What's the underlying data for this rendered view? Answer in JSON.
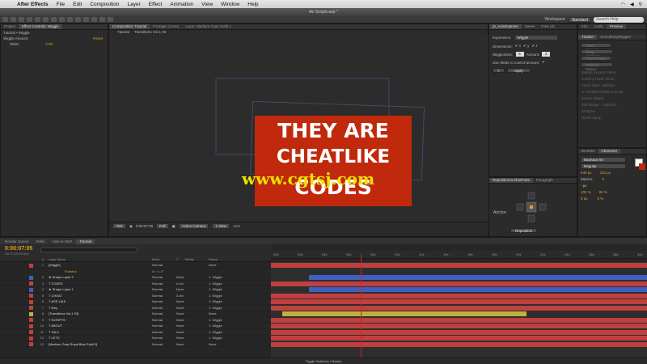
{
  "menubar": {
    "apple": "",
    "app": "After Effects",
    "items": [
      "File",
      "Edit",
      "Composition",
      "Layer",
      "Effect",
      "Animation",
      "View",
      "Window",
      "Help"
    ],
    "clock": ""
  },
  "window": {
    "title": "Ae Scripts.aep *"
  },
  "toolbar": {
    "workspace_label": "Workspace:",
    "workspace": "Standard",
    "search_placeholder": "Search Help"
  },
  "effects_panel": {
    "tabs": [
      "Project",
      "Effect Controls: Wiggle"
    ],
    "breadcrumb": "Tutorial • Wiggle",
    "rows": [
      {
        "label": "Wiggle Amount",
        "value": "Reset"
      },
      {
        "label": "Slider",
        "value": "2.00"
      }
    ]
  },
  "comp_panel": {
    "tabs": [
      "Composition: Tutorial",
      "Footage: (none)",
      "Layer: Medium Cyan Solid 1"
    ],
    "breadcrumb": [
      "Tutorial",
      "Transitions Vol.1 03"
    ],
    "art_lines": [
      "THEY ARE",
      "CHEATLIKE",
      "CODES"
    ],
    "watermark": "www.cgtsj.com",
    "viewer_bar": {
      "zoom": "75%",
      "time": "0:00:07:05",
      "resolution": "Full",
      "camera": "Active Camera",
      "views": "1 View",
      "exposure": "+0.0"
    }
  },
  "script_panel": {
    "tab": "pt_AutoExpress",
    "tabs2": [
      "Sweet",
      "Free Lib"
    ],
    "expression_label": "Expression:",
    "expression": "Wiggle",
    "dimensions_label": "Dimensions:",
    "dims": [
      "✔ x",
      "✔ y",
      "✔ z"
    ],
    "wiggles_label": "Wiggles/sec:",
    "wiggles": "5",
    "amount_label": "Amount:",
    "amount": "2",
    "slider_label": "Use Slider to control amount:",
    "help": "?",
    "apply": "Apply"
  },
  "anchor_panel": {
    "tabs": [
      "RepositionAnchorPoint",
      "Paragraph"
    ],
    "label": "Anchor:",
    "button": "Reposition"
  },
  "tracker_panel": {
    "tabs": [
      "Info",
      "Audio",
      "Preview"
    ],
    "tabs2": [
      "Tracker",
      "Smoothing/Wiggler"
    ],
    "buttons": [
      "Track Camera",
      "Warp Stabilizer",
      "Track Motion",
      "Stabilize Motion"
    ],
    "lines": [
      "Motion Source: None",
      "Current Track: None",
      "Track Type: Stabilize",
      "✔ Position  Rotation  Scale",
      "Motion Target:",
      "Edit Target...  Options...",
      "Analyze:",
      "Reset  Apply"
    ]
  },
  "char_panel": {
    "tabs": [
      "Brushes",
      "Character"
    ],
    "font": "Bauhaus 93",
    "style": "Regular",
    "size": "549 px",
    "leading": "233 px",
    "tracking": "0",
    "kerning": "Metrics",
    "units": "- px",
    "vscale": "100 %",
    "hscale": "89 %",
    "baseline": "0 px",
    "tsume": "0 %"
  },
  "timeline": {
    "tabs": [
      "Render Queue",
      "Wells",
      "How to Start",
      "Tutorial"
    ],
    "timecode": "0:00:07:05",
    "fps": "00173 (23.976 fps)",
    "columns": [
      "#",
      "Layer Name",
      "Mode",
      "T",
      "TrkMat",
      "Parent"
    ],
    "ruler_labels": [
      "00s",
      "02s",
      "04s",
      "06s",
      "08s",
      "10s",
      "12s",
      "14s",
      "16s",
      "18s",
      "20s",
      "22s",
      "24s",
      "26s",
      "28s",
      "30s"
    ],
    "expression_sub": "Rotation",
    "expression_val": "0x +1.6°",
    "layers": [
      {
        "num": "1",
        "name": "[Wiggle]",
        "mode": "Normal",
        "trk": "",
        "parent": "None",
        "color": "#c04040"
      },
      {
        "num": "2",
        "name": "★ Shape Layer 2",
        "mode": "Normal",
        "trk": "None",
        "parent": "1. Wiggle",
        "color": "#4060c0"
      },
      {
        "num": "3",
        "name": "T CODES",
        "mode": "Normal",
        "trk": "A.Inv",
        "parent": "1. Wiggle",
        "color": "#c04040"
      },
      {
        "num": "4",
        "name": "★ Shape Layer 1",
        "mode": "Normal",
        "trk": "None",
        "parent": "1. Wiggle",
        "color": "#4060c0"
      },
      {
        "num": "5",
        "name": "T CHEAT",
        "mode": "Normal",
        "trk": "A.Inv",
        "parent": "1. Wiggle",
        "color": "#c04040"
      },
      {
        "num": "6",
        "name": "T ARE LIKE",
        "mode": "Normal",
        "trk": "None",
        "parent": "1. Wiggle",
        "color": "#c04040"
      },
      {
        "num": "7",
        "name": "T they",
        "mode": "Normal",
        "trk": "None",
        "parent": "1. Wiggle",
        "color": "#c04040"
      },
      {
        "num": "8",
        "name": "[Transitions Vol.1 03]",
        "mode": "Normal",
        "trk": "None",
        "parent": "None",
        "color": "#c0b040"
      },
      {
        "num": "9",
        "name": "T SCRIPTS",
        "mode": "Normal",
        "trk": "None",
        "parent": "1. Wiggle",
        "color": "#c04040"
      },
      {
        "num": "10",
        "name": "T ABOUT",
        "mode": "Normal",
        "trk": "None",
        "parent": "1. Wiggle",
        "color": "#c04040"
      },
      {
        "num": "11",
        "name": "T TALK",
        "mode": "Normal",
        "trk": "None",
        "parent": "1. Wiggle",
        "color": "#c04040"
      },
      {
        "num": "12",
        "name": "T LETS",
        "mode": "Normal",
        "trk": "None",
        "parent": "1. Wiggle",
        "color": "#c04040"
      },
      {
        "num": "13",
        "name": "[Medium Gray-Royal Blue Solid 3]",
        "mode": "Normal",
        "trk": "None",
        "parent": "None",
        "color": "#c04040"
      }
    ],
    "footer": "Toggle Switches / Modes"
  },
  "colors": {
    "accent": "#e0a020",
    "art_bg": "#c0290c",
    "playhead": "#d02020"
  }
}
